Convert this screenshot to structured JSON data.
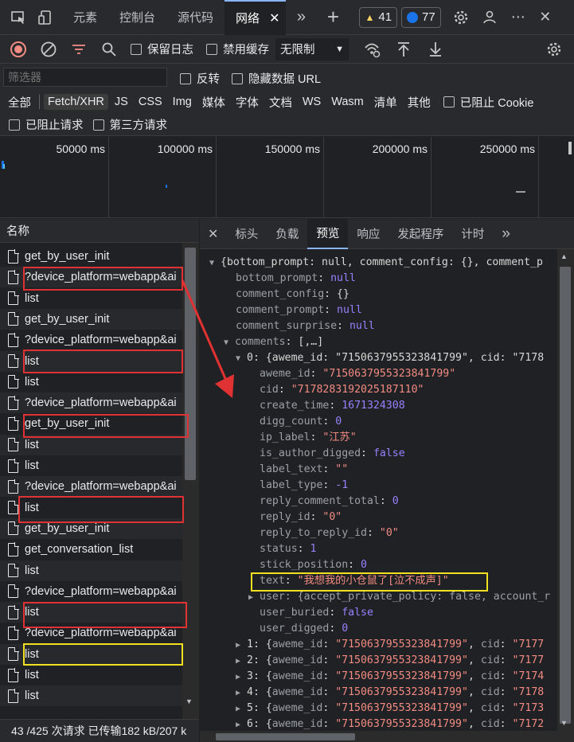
{
  "top_tabs": {
    "elements": "元素",
    "console": "控制台",
    "sources": "源代码",
    "network": "网络"
  },
  "badges": {
    "warnings": "41",
    "issues": "77"
  },
  "toolbar": {
    "preserve_log": "保留日志",
    "disable_cache": "禁用缓存",
    "throttling": "无限制"
  },
  "filter": {
    "placeholder": "筛选器",
    "invert": "反转",
    "hide_data_urls": "隐藏数据 URL"
  },
  "types": [
    "全部",
    "Fetch/XHR",
    "JS",
    "CSS",
    "Img",
    "媒体",
    "字体",
    "文档",
    "WS",
    "Wasm",
    "清单",
    "其他"
  ],
  "blocked_cookies": "已阻止 Cookie",
  "blocked_requests": "已阻止请求",
  "third_party": "第三方请求",
  "timeline_ticks": [
    "50000 ms",
    "100000 ms",
    "150000 ms",
    "200000 ms",
    "250000 ms"
  ],
  "requests_header": "名称",
  "requests": [
    "get_by_user_init",
    "?device_platform=webapp&ai",
    "list",
    "get_by_user_init",
    "?device_platform=webapp&ai",
    "list",
    "list",
    "?device_platform=webapp&ai",
    "get_by_user_init",
    "list",
    "list",
    "?device_platform=webapp&ai",
    "list",
    "get_by_user_init",
    "get_conversation_list",
    "list",
    "?device_platform=webapp&ai",
    "list",
    "?device_platform=webapp&ai",
    "list",
    "list",
    "list"
  ],
  "status_bar": "43 /425 次请求  已传输182 kB/207 k",
  "detail_tabs": [
    "标头",
    "负载",
    "预览",
    "响应",
    "发起程序",
    "计时"
  ],
  "preview": {
    "root": "{bottom_prompt: null, comment_config: {}, comment_p",
    "lines": [
      {
        "key": "bottom_prompt",
        "val": "null",
        "kind": "kw"
      },
      {
        "key": "comment_config",
        "val": "{}",
        "kind": "pk"
      },
      {
        "key": "comment_prompt",
        "val": "null",
        "kind": "kw"
      },
      {
        "key": "comment_surprise",
        "val": "null",
        "kind": "kw"
      }
    ],
    "comments_key": "comments",
    "comments_val": "[,…]",
    "item0_head": "0: {aweme_id: \"7150637955323841799\", cid: \"7178",
    "item0": [
      {
        "key": "aweme_id",
        "val": "\"7150637955323841799\"",
        "kind": "str"
      },
      {
        "key": "cid",
        "val": "\"7178283192025187110\"",
        "kind": "str"
      },
      {
        "key": "create_time",
        "val": "1671324308",
        "kind": "num"
      },
      {
        "key": "digg_count",
        "val": "0",
        "kind": "num"
      },
      {
        "key": "ip_label",
        "val": "\"江苏\"",
        "kind": "str"
      },
      {
        "key": "is_author_digged",
        "val": "false",
        "kind": "kw"
      },
      {
        "key": "label_text",
        "val": "\"\"",
        "kind": "str"
      },
      {
        "key": "label_type",
        "val": "-1",
        "kind": "num"
      },
      {
        "key": "reply_comment_total",
        "val": "0",
        "kind": "num"
      },
      {
        "key": "reply_id",
        "val": "\"0\"",
        "kind": "str"
      },
      {
        "key": "reply_to_reply_id",
        "val": "\"0\"",
        "kind": "str"
      },
      {
        "key": "status",
        "val": "1",
        "kind": "num"
      },
      {
        "key": "stick_position",
        "val": "0",
        "kind": "num"
      },
      {
        "key": "text",
        "val": "\"我想我的小仓鼠了[泣不成声]\"",
        "kind": "str"
      }
    ],
    "user_line": "user: {accept_private_policy: false, account_r",
    "item0_tail": [
      {
        "key": "user_buried",
        "val": "false",
        "kind": "kw"
      },
      {
        "key": "user_digged",
        "val": "0",
        "kind": "num"
      }
    ],
    "collapsed": [
      {
        "idx": "1",
        "cid": "\"7177"
      },
      {
        "idx": "2",
        "cid": "\"7177"
      },
      {
        "idx": "3",
        "cid": "\"7174"
      },
      {
        "idx": "4",
        "cid": "\"7178"
      },
      {
        "idx": "5",
        "cid": "\"7173"
      },
      {
        "idx": "6",
        "cid": "\"7172"
      }
    ],
    "collapsed_aweme": "\"7150637955323841799\""
  },
  "colors": {
    "annotation_red": "#e03232",
    "annotation_yellow": "#f0e020",
    "accent": "#8ab4f8"
  }
}
